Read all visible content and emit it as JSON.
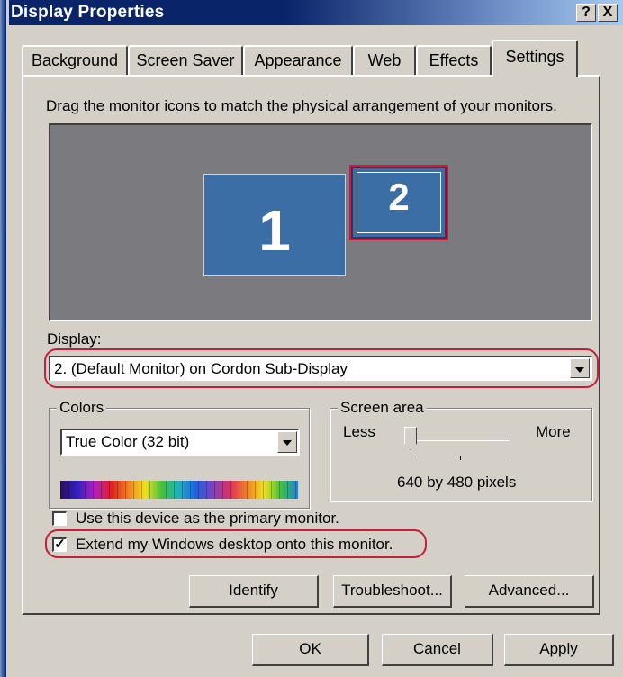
{
  "window": {
    "title": "Display Properties",
    "help_label": "?",
    "close_label": "X"
  },
  "tabs": [
    {
      "label": "Background"
    },
    {
      "label": "Screen Saver"
    },
    {
      "label": "Appearance"
    },
    {
      "label": "Web"
    },
    {
      "label": "Effects"
    },
    {
      "label": "Settings",
      "active": true
    }
  ],
  "settings": {
    "hint": "Drag the monitor icons to match the physical arrangement of your monitors.",
    "monitors": [
      {
        "number": "1"
      },
      {
        "number": "2",
        "selected": true
      }
    ],
    "display_label": "Display:",
    "display_value": "2. (Default Monitor) on Cordon Sub-Display",
    "colors": {
      "legend": "Colors",
      "value": "True Color (32 bit)"
    },
    "screen_area": {
      "legend": "Screen area",
      "less_label": "Less",
      "more_label": "More",
      "resolution": "640 by 480 pixels",
      "slider_level": 0
    },
    "primary_checkbox": {
      "label": "Use this device as the primary monitor.",
      "checked": false
    },
    "extend_checkbox": {
      "label": "Extend my Windows desktop onto this monitor.",
      "checked": true
    },
    "buttons": {
      "identify": "Identify",
      "troubleshoot": "Troubleshoot...",
      "advanced": "Advanced..."
    }
  },
  "dialog_buttons": {
    "ok": "OK",
    "cancel": "Cancel",
    "apply": "Apply"
  },
  "colors": {
    "title_bar": "#0a246a",
    "face": "#d4d0c8",
    "monitor_fill": "#3a6ea5",
    "preview_bg": "#7b7a7e",
    "highlight_ring": "#c41e3a"
  }
}
